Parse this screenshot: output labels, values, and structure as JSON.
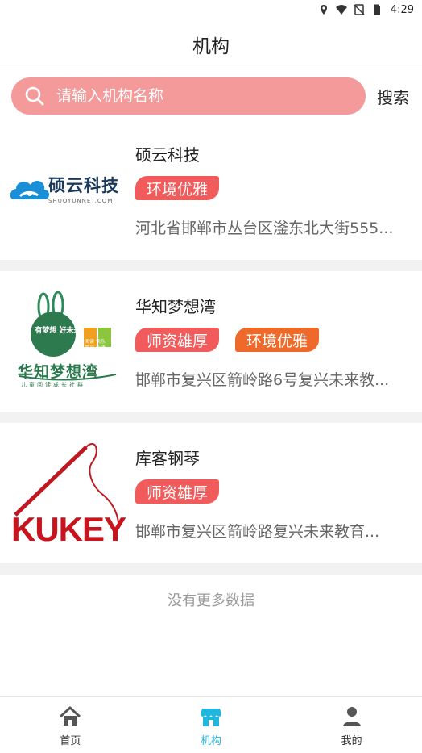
{
  "status_bar": {
    "time": "4:29",
    "icons": [
      "location-icon",
      "wifi-icon",
      "no-signal-icon",
      "battery-icon"
    ]
  },
  "header": {
    "title": "机构"
  },
  "search": {
    "placeholder": "请输入机构名称",
    "value": "",
    "button_label": "搜索"
  },
  "institutions": [
    {
      "name": "硕云科技",
      "logo_text": "硕云科技",
      "logo_subtext": "SHUOYUNNET.COM",
      "tags": [
        {
          "label": "环境优雅",
          "color": "#f25b5b"
        }
      ],
      "address": "河北省邯郸市丛台区滏东北大街555..."
    },
    {
      "name": "华知梦想湾",
      "logo_text": "华知梦想湾",
      "logo_subtext": "儿童阅读成长社群",
      "logo_badge": "有梦想 好未来",
      "logo_side": "阅读 快乐 学习 生活",
      "tags": [
        {
          "label": "师资雄厚",
          "color": "#f25b5b"
        },
        {
          "label": "环境优雅",
          "color": "#ef6a2a"
        }
      ],
      "address": "邯郸市复兴区箭岭路6号复兴未来教..."
    },
    {
      "name": "库客钢琴",
      "logo_text": "KUKEY",
      "tags": [
        {
          "label": "师资雄厚",
          "color": "#f25b5b"
        }
      ],
      "address": "邯郸市复兴区箭岭路复兴未来教育..."
    }
  ],
  "footer_note": "没有更多数据",
  "tabbar": {
    "items": [
      {
        "label": "首页",
        "icon": "home-icon",
        "active": false
      },
      {
        "label": "机构",
        "icon": "store-icon",
        "active": true
      },
      {
        "label": "我的",
        "icon": "user-icon",
        "active": false
      }
    ],
    "active_color": "#1fb6e0",
    "inactive_color": "#555555"
  },
  "colors": {
    "search_bg": "#f49a9a",
    "tag_red": "#f25b5b",
    "tag_orange": "#ef6a2a"
  }
}
